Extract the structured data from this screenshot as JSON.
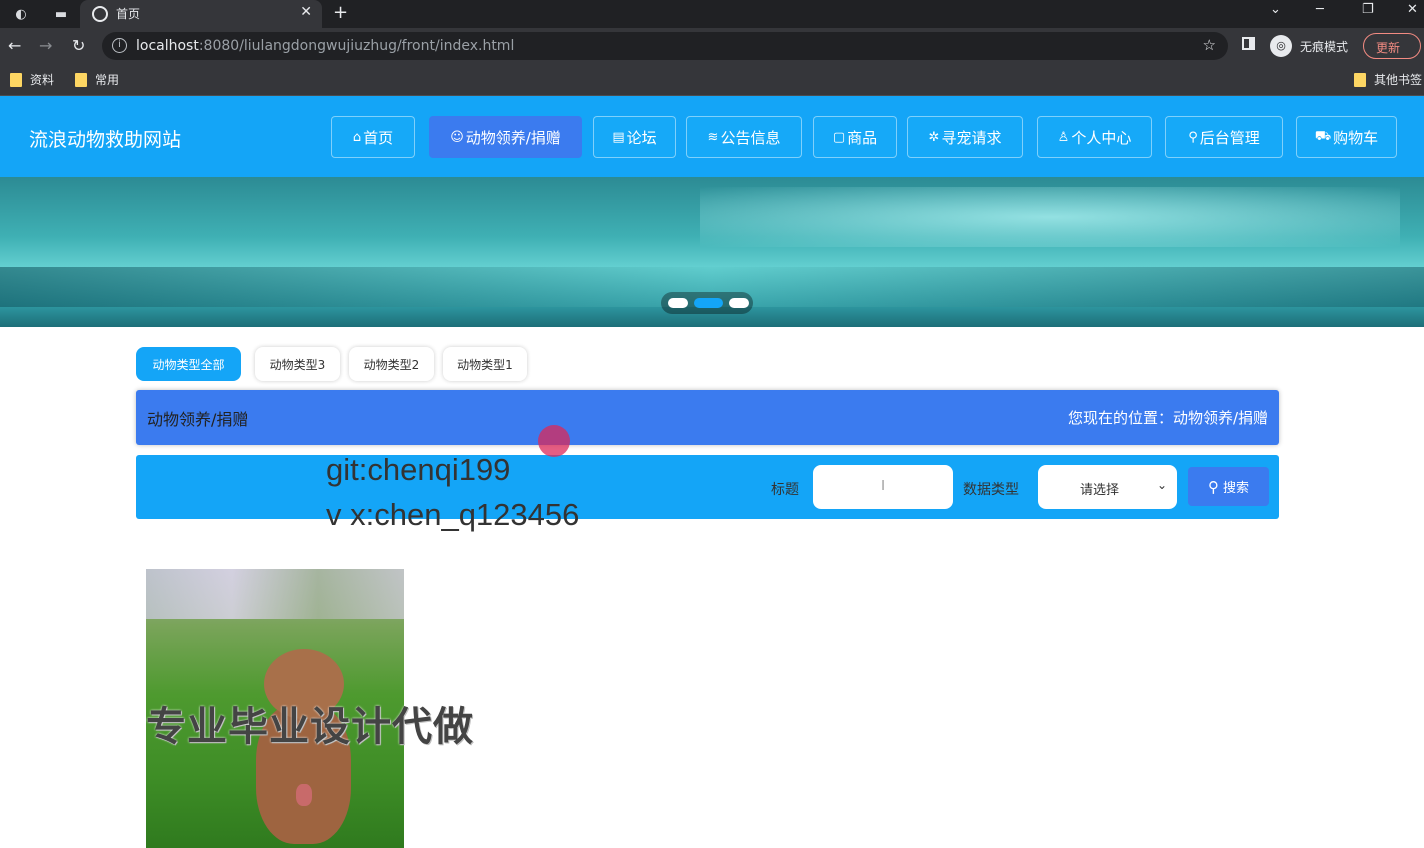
{
  "browser": {
    "tab_title": "首页",
    "url_host": "localhost",
    "url_rest": ":8080/liulangdongwujiuzhug/front/index.html",
    "incognito_label": "无痕模式",
    "update_label": "更新",
    "bookmarks": [
      "资料",
      "常用"
    ],
    "other_bookmarks": "其他书签"
  },
  "site": {
    "title": "流浪动物救助网站",
    "nav": [
      {
        "icon": "⌂",
        "label": "首页"
      },
      {
        "icon": "☺",
        "label": "动物领养/捐赠"
      },
      {
        "icon": "▤",
        "label": "论坛"
      },
      {
        "icon": "≋",
        "label": "公告信息"
      },
      {
        "icon": "▢",
        "label": "商品"
      },
      {
        "icon": "✲",
        "label": "寻宠请求"
      },
      {
        "icon": "♙",
        "label": "个人中心"
      },
      {
        "icon": "⚲",
        "label": "后台管理"
      },
      {
        "icon": "⛟",
        "label": "购物车"
      }
    ],
    "filters": [
      "动物类型全部",
      "动物类型3",
      "动物类型2",
      "动物类型1"
    ],
    "breadcrumb": {
      "section": "动物领养/捐赠",
      "location": "您现在的位置：动物领养/捐赠"
    },
    "search": {
      "title_label": "标题",
      "title_value": "I",
      "type_label": "数据类型",
      "type_value": "请选择",
      "button_label": "搜索"
    },
    "watermarks": {
      "line1": "git:chenqi199",
      "line2": "v x:chen_q123456",
      "overlay": "专业毕业设计代做"
    }
  },
  "colors": {
    "header_blue": "#14a5f7",
    "active_blue": "#3b7bef"
  }
}
